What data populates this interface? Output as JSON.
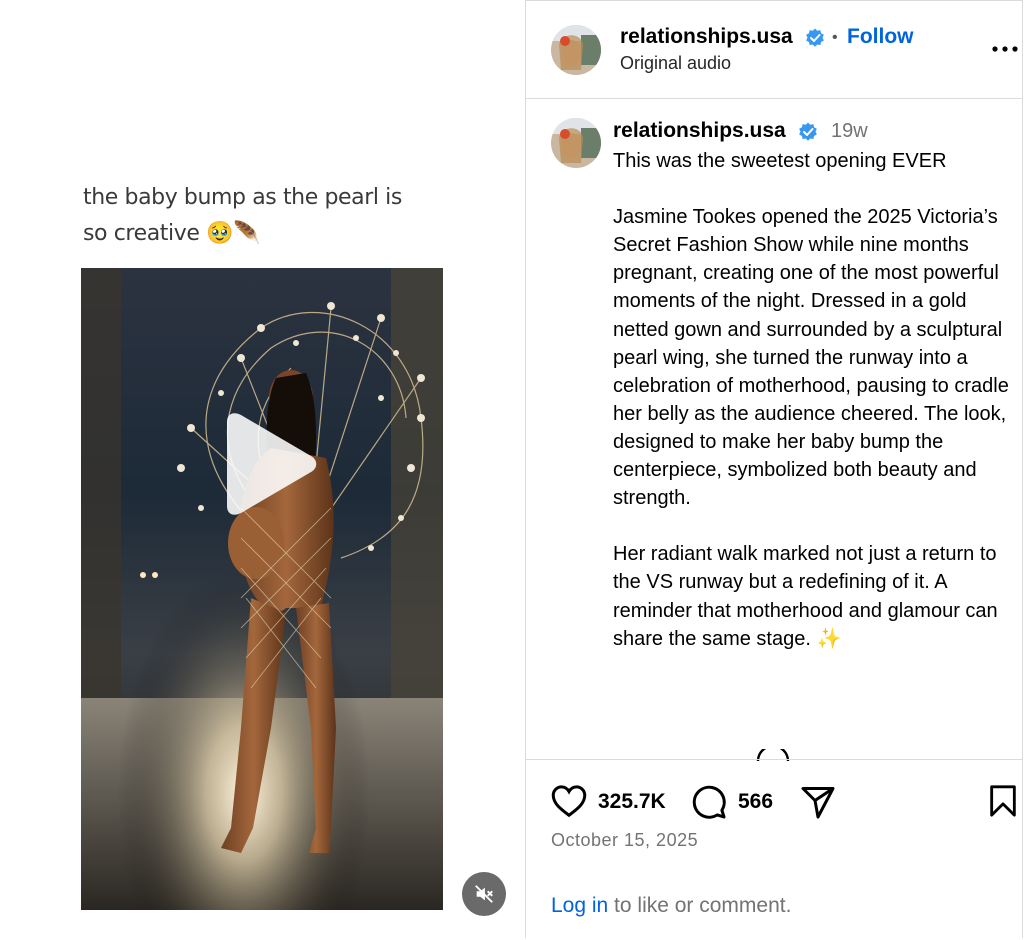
{
  "media": {
    "overlay_caption_line1": "the baby bump as the pearl is",
    "overlay_caption_line2": "so creative 🥹🪶"
  },
  "header": {
    "username": "relationships.usa",
    "separator": "•",
    "follow_label": "Follow",
    "audio_label": "Original audio"
  },
  "post": {
    "username": "relationships.usa",
    "time_ago": "19w",
    "caption": "This was the sweetest opening EVER\n\nJasmine Tookes opened the 2025 Victoria’s Secret Fashion Show while nine months pregnant, creating one of the most powerful moments of the night. Dressed in a gold netted gown and surrounded by a sculptural pearl wing, she turned the runway into a celebration of motherhood, pausing to cradle her belly as the audience cheered. The look, designed to make her baby bump the centerpiece, symbolized both beauty and strength.\n\nHer radiant walk marked not just a return to the VS runway but a redefining of it. A reminder that motherhood and glamour can share the same stage. ✨"
  },
  "actions": {
    "likes": "325.7K",
    "comments": "566",
    "date": "October 15, 2025",
    "login_link": "Log in",
    "login_rest": " to like or comment."
  },
  "colors": {
    "link": "#0064e0",
    "verified": "#3897f0",
    "muted": "#737373",
    "border": "#dbdbdb"
  }
}
